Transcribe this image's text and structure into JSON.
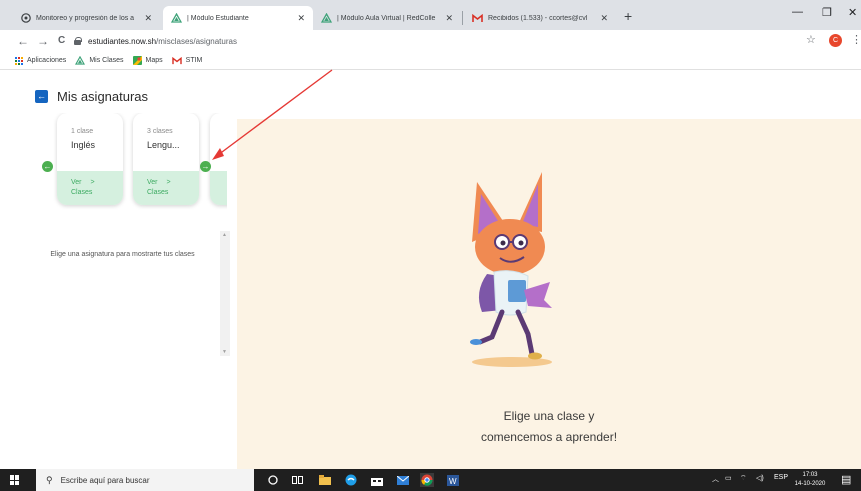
{
  "browser": {
    "tabs": [
      {
        "title": "Monitoreo y progresión de los a",
        "icon": "gear-globe-icon",
        "active": false
      },
      {
        "title": "| Módulo Estudiante",
        "icon": "triangle-logo-icon",
        "active": true
      },
      {
        "title": "| Módulo Aula Virtual | RedColle",
        "icon": "triangle-logo-icon",
        "active": false
      },
      {
        "title": "Recibidos (1.533) - ccortes@cvl",
        "icon": "gmail-icon",
        "active": false
      }
    ],
    "tab_close": "✕",
    "new_tab": "+",
    "window_controls": {
      "minimize": "—",
      "restore": "❐",
      "close": "✕"
    },
    "nav": {
      "back": "←",
      "forward": "→",
      "reload": "C"
    },
    "url": {
      "host": "estudiantes.now.sh",
      "path": "/misclases/asignaturas"
    },
    "star": "☆",
    "profile_initial": "C",
    "menu": "⋮",
    "bookmarks": [
      {
        "label": "Aplicaciones",
        "icon": "apps-grid-icon"
      },
      {
        "label": "Mis Clases",
        "icon": "triangle-logo-icon"
      },
      {
        "label": "Maps",
        "icon": "maps-icon"
      },
      {
        "label": "STIM",
        "icon": "gmail-icon"
      }
    ]
  },
  "page": {
    "back_icon": "←",
    "title": "Mis asignaturas",
    "subjects": [
      {
        "count": "1 clase",
        "name": "Inglés",
        "link": "Ver",
        "link2": "Clases",
        "chevron": ">"
      },
      {
        "count": "3 clases",
        "name": "Lengu...",
        "link": "Ver",
        "link2": "Clases",
        "chevron": ">"
      }
    ],
    "prev_arrow": "←",
    "next_arrow": "→",
    "empty_message": "Elige una asignatura para mostrarte tus clases",
    "scroll_up": "▲",
    "scroll_down": "▼",
    "cta_line1": "Elige una clase y",
    "cta_line2": "comencemos a aprender!",
    "colors": {
      "accent": "#4caf50",
      "card_footer": "#d5f0df",
      "panel_bg": "#fcf3e4",
      "back_button": "#1565c0",
      "annotation_arrow": "#e53935"
    }
  },
  "taskbar": {
    "search_placeholder": "Escribe aquí para buscar",
    "language": "ESP",
    "time": "17:03",
    "date": "14-10-2020",
    "tray_icons": [
      "chevron-up-icon",
      "network-icon",
      "wifi-icon",
      "volume-icon"
    ],
    "apps": [
      "cortana-icon",
      "task-view-icon",
      "file-explorer-icon",
      "edge-icon",
      "store-icon",
      "mail-icon",
      "chrome-icon",
      "word-icon"
    ]
  }
}
